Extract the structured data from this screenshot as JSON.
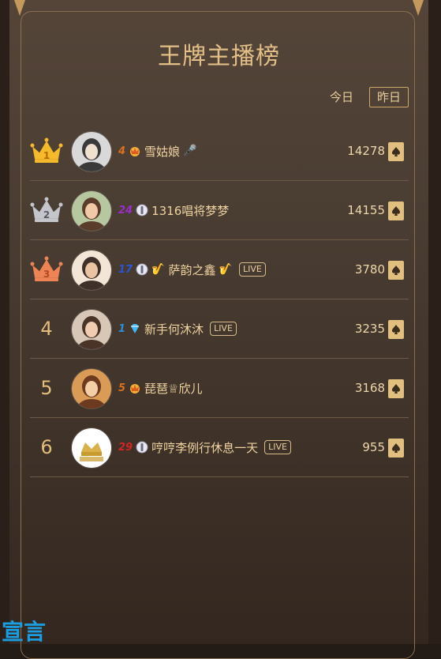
{
  "page": {
    "title": "王牌主播榜",
    "watermark": "宣言"
  },
  "tabs": [
    {
      "label": "今日",
      "active": false
    },
    {
      "label": "昨日",
      "active": true
    }
  ],
  "colors": {
    "accent": "#e2bf86",
    "gold_crown": "#f5b92c",
    "silver_crown": "#c5c6cc",
    "bronze_crown": "#ee8456"
  },
  "ranking": [
    {
      "rank": "1",
      "level": "4",
      "level_color": "#d7701f",
      "badge_icon": "crown-badge-icon",
      "name": "雪姑娘",
      "deco": "🎤",
      "live": "",
      "score": "14278",
      "gift_icon": "spade-icon"
    },
    {
      "rank": "2",
      "level": "24",
      "level_color": "#9b2dc9",
      "badge_icon": "shield-badge-icon",
      "name": "1316唱将梦梦",
      "deco": "",
      "live": "",
      "score": "14155",
      "gift_icon": "spade-icon"
    },
    {
      "rank": "3",
      "level": "17",
      "level_color": "#2a55d8",
      "badge_icon": "shield-badge-icon",
      "name": "萨韵之鑫",
      "deco": "🎷",
      "live": "LIVE",
      "score": "3780",
      "gift_icon": "spade-icon"
    },
    {
      "rank": "4",
      "level": "1",
      "level_color": "#2a8fd8",
      "badge_icon": "diamond-badge-icon",
      "name": "新手何沐沐",
      "deco": "",
      "live": "LIVE",
      "score": "3235",
      "gift_icon": "spade-icon"
    },
    {
      "rank": "5",
      "level": "5",
      "level_color": "#d7701f",
      "badge_icon": "crown-badge-icon",
      "name": "琵琶♕欣儿",
      "deco": "",
      "live": "",
      "score": "3168",
      "gift_icon": "spade-icon"
    },
    {
      "rank": "6",
      "level": "29",
      "level_color": "#d42525",
      "badge_icon": "shield-badge-icon",
      "name": "哼哼李例行休息一天",
      "deco": "",
      "live": "LIVE",
      "score": "955",
      "gift_icon": "spade-icon"
    }
  ]
}
